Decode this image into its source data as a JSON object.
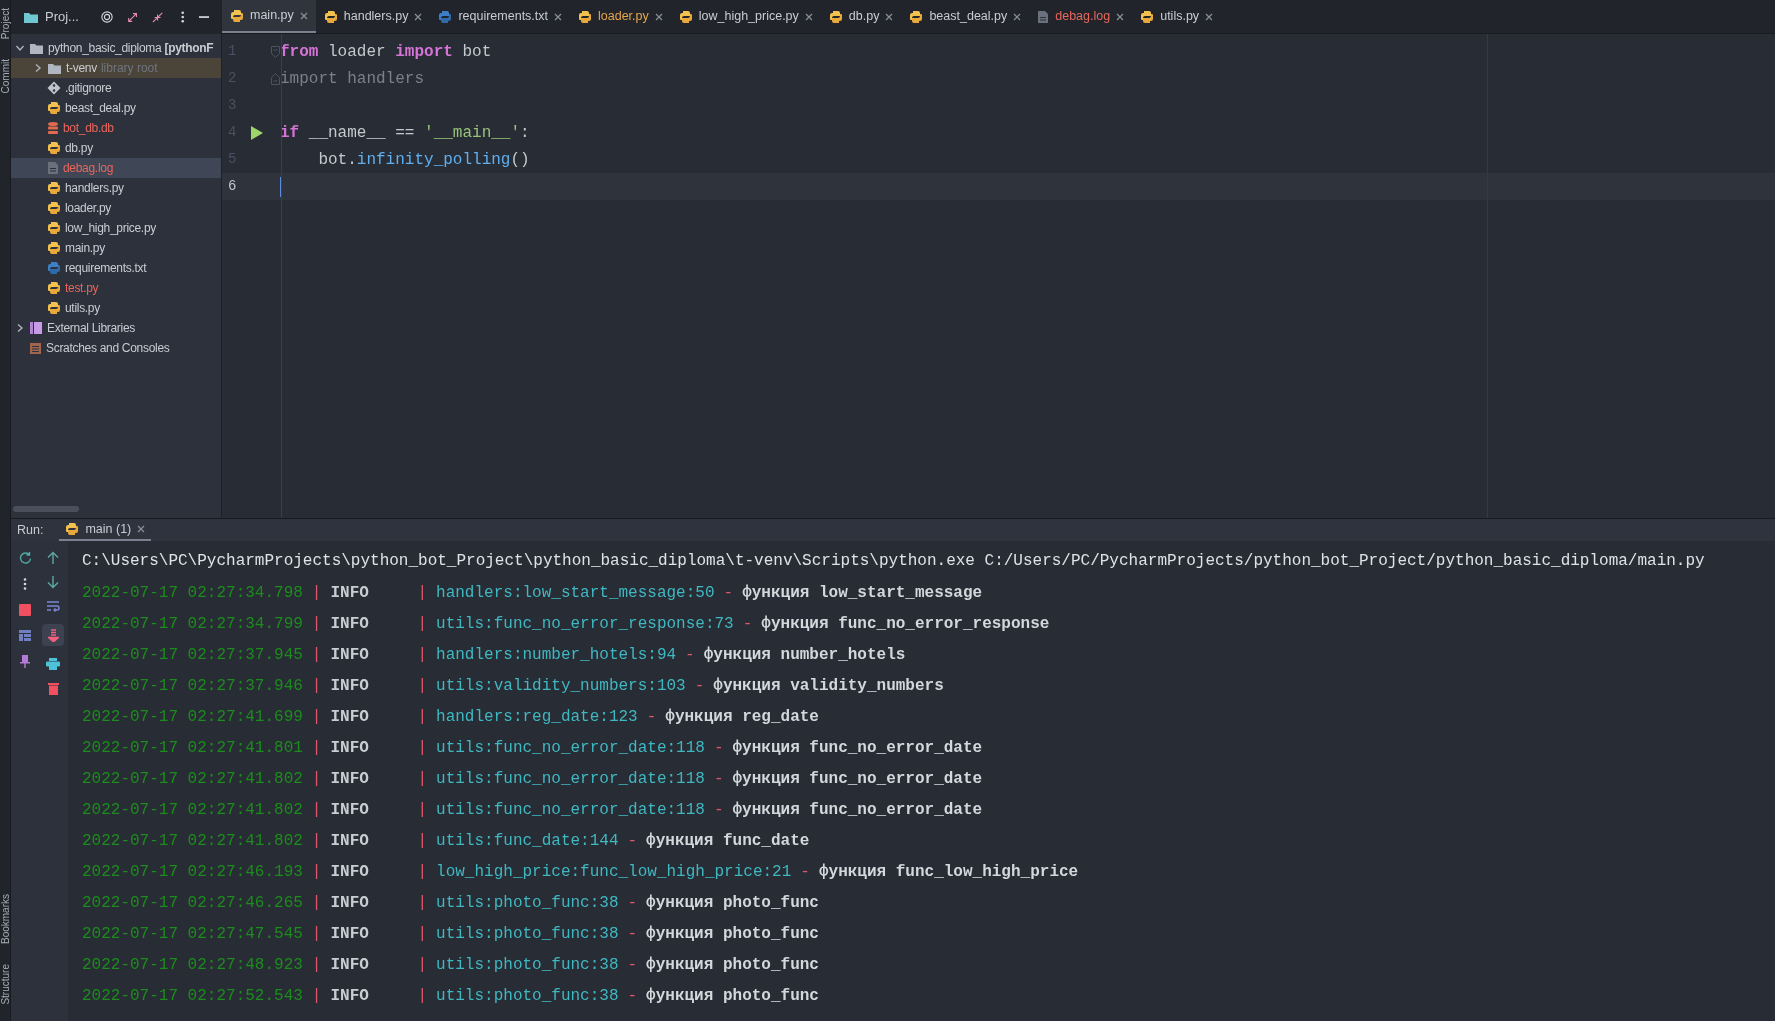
{
  "side_strip": {
    "top": [
      "Project",
      "Commit"
    ],
    "bottom": [
      "Bookmarks",
      "Structure"
    ]
  },
  "project_panel": {
    "title": "Proj...",
    "tree": [
      {
        "label": "python_basic_diploma **[pythonF**",
        "kind": "folder",
        "expanded": true,
        "selected": false,
        "highlighted": false,
        "unversioned": false,
        "children": [
          {
            "label": "t-venv",
            "hint": "library root",
            "kind": "folder",
            "expanded": false,
            "selected": false,
            "highlighted": true,
            "unversioned": false
          },
          {
            "label": ".gitignore",
            "kind": "gitignore",
            "selected": false,
            "highlighted": false,
            "unversioned": false
          },
          {
            "label": "beast_deal.py",
            "kind": "python",
            "selected": false,
            "highlighted": false,
            "unversioned": false
          },
          {
            "label": "bot_db.db",
            "kind": "database",
            "selected": false,
            "highlighted": false,
            "unversioned": true
          },
          {
            "label": "db.py",
            "kind": "python",
            "selected": false,
            "highlighted": false,
            "unversioned": false
          },
          {
            "label": "debag.log",
            "kind": "log",
            "selected": true,
            "highlighted": false,
            "unversioned": true
          },
          {
            "label": "handlers.py",
            "kind": "python",
            "selected": false,
            "highlighted": false,
            "unversioned": false
          },
          {
            "label": "loader.py",
            "kind": "python",
            "selected": false,
            "highlighted": false,
            "unversioned": false
          },
          {
            "label": "low_high_price.py",
            "kind": "python",
            "selected": false,
            "highlighted": false,
            "unversioned": false
          },
          {
            "label": "main.py",
            "kind": "python",
            "selected": false,
            "highlighted": false,
            "unversioned": false
          },
          {
            "label": "requirements.txt",
            "kind": "requirements",
            "selected": false,
            "highlighted": false,
            "unversioned": false
          },
          {
            "label": "test.py",
            "kind": "python",
            "selected": false,
            "highlighted": false,
            "unversioned": true
          },
          {
            "label": "utils.py",
            "kind": "python",
            "selected": false,
            "highlighted": false,
            "unversioned": false
          }
        ]
      },
      {
        "label": "External Libraries",
        "kind": "libraries",
        "expanded": false,
        "selected": false,
        "highlighted": false,
        "unversioned": false
      },
      {
        "label": "Scratches and Consoles",
        "kind": "scratches",
        "selected": false,
        "highlighted": false,
        "unversioned": false
      }
    ]
  },
  "tabs": [
    {
      "label": "main.py",
      "kind": "python",
      "selected": true,
      "modified": false,
      "unversioned": false
    },
    {
      "label": "handlers.py",
      "kind": "python",
      "selected": false,
      "modified": false,
      "unversioned": false
    },
    {
      "label": "requirements.txt",
      "kind": "requirements",
      "selected": false,
      "modified": false,
      "unversioned": false
    },
    {
      "label": "loader.py",
      "kind": "python",
      "selected": false,
      "modified": true,
      "unversioned": false
    },
    {
      "label": "low_high_price.py",
      "kind": "python",
      "selected": false,
      "modified": false,
      "unversioned": false
    },
    {
      "label": "db.py",
      "kind": "python",
      "selected": false,
      "modified": false,
      "unversioned": false
    },
    {
      "label": "beast_deal.py",
      "kind": "python",
      "selected": false,
      "modified": false,
      "unversioned": false
    },
    {
      "label": "debag.log",
      "kind": "log",
      "selected": false,
      "modified": false,
      "unversioned": true
    },
    {
      "label": "utils.py",
      "kind": "python",
      "selected": false,
      "modified": false,
      "unversioned": false
    }
  ],
  "editor": {
    "lines": [
      {
        "number": "1",
        "kind": "opener",
        "current": false,
        "tokens": [
          {
            "text": "from",
            "kind": "keyword"
          },
          {
            "text": " loader ",
            "kind": "plain"
          },
          {
            "text": "import",
            "kind": "keyword"
          },
          {
            "text": " bot",
            "kind": "plain"
          }
        ]
      },
      {
        "number": "2",
        "kind": "closer",
        "current": false,
        "tokens": [
          {
            "text": "import handlers",
            "kind": "unused"
          }
        ]
      },
      {
        "number": "3",
        "kind": "plain",
        "current": false
      },
      {
        "number": "4",
        "kind": "entry",
        "current": false,
        "tokens": [
          {
            "text": "if",
            "kind": "keyword"
          },
          {
            "text": " __name__ == ",
            "kind": "plain"
          },
          {
            "text": "'__main__'",
            "kind": "string"
          },
          {
            "text": ":",
            "kind": "plain"
          }
        ]
      },
      {
        "number": "5",
        "kind": "plain",
        "current": false,
        "tokens": [
          {
            "text": "    bot.",
            "kind": "plain"
          },
          {
            "text": "infinity_polling",
            "kind": "call"
          },
          {
            "text": "()",
            "kind": "plain"
          }
        ]
      },
      {
        "number": "6",
        "kind": "plain",
        "current": true
      }
    ]
  },
  "run_bar": {
    "label": "Run:",
    "tab": {
      "label": "main (1)",
      "selected": true
    }
  },
  "console": {
    "command": "C:\\Users\\PC\\PycharmProjects\\python_bot_Project\\python_basic_diploma\\t-venv\\Scripts\\python.exe C:/Users/PC/PycharmProjects/python_bot_Project/python_basic_diploma/main.py",
    "rows": [
      {
        "timestamp": "2022-07-17 02:27:34.798",
        "pipe_1": "|",
        "level": "INFO",
        "pipe_2": "|",
        "source": "handlers:low_start_message:50",
        "dash": "-",
        "message": "функция low_start_message"
      },
      {
        "timestamp": "2022-07-17 02:27:34.799",
        "pipe_1": "|",
        "level": "INFO",
        "pipe_2": "|",
        "source": "utils:func_no_error_response:73",
        "dash": "-",
        "message": "функция func_no_error_response"
      },
      {
        "timestamp": "2022-07-17 02:27:37.945",
        "pipe_1": "|",
        "level": "INFO",
        "pipe_2": "|",
        "source": "handlers:number_hotels:94",
        "dash": "-",
        "message": "функция number_hotels"
      },
      {
        "timestamp": "2022-07-17 02:27:37.946",
        "pipe_1": "|",
        "level": "INFO",
        "pipe_2": "|",
        "source": "utils:validity_numbers:103",
        "dash": "-",
        "message": "функция validity_numbers"
      },
      {
        "timestamp": "2022-07-17 02:27:41.699",
        "pipe_1": "|",
        "level": "INFO",
        "pipe_2": "|",
        "source": "handlers:reg_date:123",
        "dash": "-",
        "message": "функция reg_date"
      },
      {
        "timestamp": "2022-07-17 02:27:41.801",
        "pipe_1": "|",
        "level": "INFO",
        "pipe_2": "|",
        "source": "utils:func_no_error_date:118",
        "dash": "-",
        "message": "функция func_no_error_date"
      },
      {
        "timestamp": "2022-07-17 02:27:41.802",
        "pipe_1": "|",
        "level": "INFO",
        "pipe_2": "|",
        "source": "utils:func_no_error_date:118",
        "dash": "-",
        "message": "функция func_no_error_date"
      },
      {
        "timestamp": "2022-07-17 02:27:41.802",
        "pipe_1": "|",
        "level": "INFO",
        "pipe_2": "|",
        "source": "utils:func_no_error_date:118",
        "dash": "-",
        "message": "функция func_no_error_date"
      },
      {
        "timestamp": "2022-07-17 02:27:41.802",
        "pipe_1": "|",
        "level": "INFO",
        "pipe_2": "|",
        "source": "utils:func_date:144",
        "dash": "-",
        "message": "функция func_date"
      },
      {
        "timestamp": "2022-07-17 02:27:46.193",
        "pipe_1": "|",
        "level": "INFO",
        "pipe_2": "|",
        "source": "low_high_price:func_low_high_price:21",
        "dash": "-",
        "message": "функция func_low_high_price"
      },
      {
        "timestamp": "2022-07-17 02:27:46.265",
        "pipe_1": "|",
        "level": "INFO",
        "pipe_2": "|",
        "source": "utils:photo_func:38",
        "dash": "-",
        "message": "функция photo_func"
      },
      {
        "timestamp": "2022-07-17 02:27:47.545",
        "pipe_1": "|",
        "level": "INFO",
        "pipe_2": "|",
        "source": "utils:photo_func:38",
        "dash": "-",
        "message": "функция photo_func"
      },
      {
        "timestamp": "2022-07-17 02:27:48.923",
        "pipe_1": "|",
        "level": "INFO",
        "pipe_2": "|",
        "source": "utils:photo_func:38",
        "dash": "-",
        "message": "функция photo_func"
      },
      {
        "timestamp": "2022-07-17 02:27:52.543",
        "pipe_1": "|",
        "level": "INFO",
        "pipe_2": "|",
        "source": "utils:photo_func:38",
        "dash": "-",
        "message": "функция photo_func"
      }
    ]
  }
}
